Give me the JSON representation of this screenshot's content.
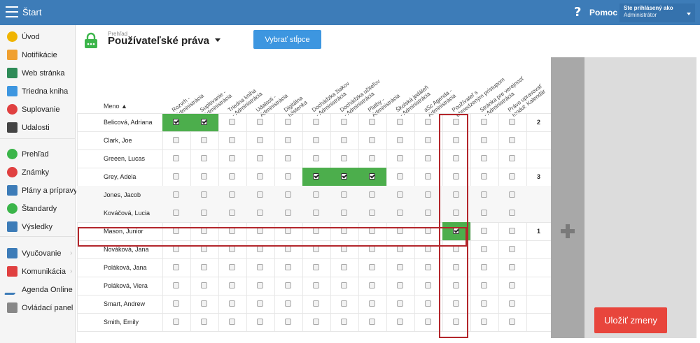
{
  "topbar": {
    "start_label": "Štart",
    "help_q": "?",
    "help_label": "Pomoc",
    "user_line1": "Ste prihlásený ako",
    "user_line2": "Administrátor"
  },
  "sidebar": {
    "items": [
      {
        "label": "Úvod",
        "icon": "star-icon",
        "color": "#f0b400"
      },
      {
        "label": "Notifikácie",
        "icon": "envelope-icon",
        "color": "#f0a030"
      },
      {
        "label": "Web stránka",
        "icon": "home-icon",
        "color": "#2e8b57"
      },
      {
        "label": "Triedna kniha",
        "icon": "book-icon",
        "color": "#3d96e0"
      },
      {
        "label": "Suplovanie",
        "icon": "person-icon",
        "color": "#e04040"
      },
      {
        "label": "Udalosti",
        "icon": "calendar-icon",
        "color": "#444444"
      },
      {
        "label": "Prehľad",
        "icon": "check-circle-icon",
        "color": "#3bb54a"
      },
      {
        "label": "Známky",
        "icon": "grade-icon",
        "color": "#e04040"
      },
      {
        "label": "Plány a prípravy",
        "icon": "briefcase-icon",
        "color": "#3d7cb8"
      },
      {
        "label": "Štandardy",
        "icon": "shield-icon",
        "color": "#3bb54a"
      },
      {
        "label": "Výsledky",
        "icon": "bar-chart-icon",
        "color": "#3d7cb8"
      },
      {
        "label": "Vyučovanie",
        "icon": "teacher-icon",
        "color": "#3d7cb8"
      },
      {
        "label": "Komunikácia",
        "icon": "chat-icon",
        "color": "#e04040"
      },
      {
        "label": "Agenda Online",
        "icon": "pencil-icon",
        "color": "#3d7cb8"
      },
      {
        "label": "Ovládací panel",
        "icon": "gear-icon",
        "color": "#888888"
      }
    ]
  },
  "header": {
    "crumb": "Prehľad",
    "title": "Používateľské práva",
    "select_columns": "Vybrať stĺpce"
  },
  "table": {
    "name_header": "Meno ▲",
    "columns": [
      [
        "Rozvrh -",
        "Administrácia"
      ],
      [
        "Suplovanie -",
        "Administrácia"
      ],
      [
        "Triedna kniha",
        "- Administrácia"
      ],
      [
        "Udalosti -",
        "Administrácia"
      ],
      [
        "Digitálna",
        "nástenka"
      ],
      [
        "Dochádzka žiakov",
        "- Administrácia"
      ],
      [
        "Dochádzka učiteľov",
        "- Administrácia"
      ],
      [
        "Platby -",
        "Administrácia"
      ],
      [
        "Školská jedáleň",
        "- Administrácia"
      ],
      [
        "aSc Agenda -",
        "Administrácia"
      ],
      [
        "Používateľ s",
        "obmedzeným prístupom"
      ],
      [
        "Stránka pre verejnosť",
        "- Administrácia"
      ],
      [
        "Právo upravovať",
        "modul: Kalendár"
      ]
    ],
    "rows": [
      {
        "name": "Belicová, Adriana",
        "checked": [
          0,
          1
        ],
        "count": "2"
      },
      {
        "name": "Clark, Joe",
        "checked": [],
        "count": ""
      },
      {
        "name": "Greeen, Lucas",
        "checked": [],
        "count": ""
      },
      {
        "name": "Grey, Adela",
        "checked": [
          5,
          6,
          7
        ],
        "count": "3"
      },
      {
        "name": "Jones, Jacob",
        "checked": [],
        "count": ""
      },
      {
        "name": "Kováčová, Lucia",
        "checked": [],
        "count": ""
      },
      {
        "name": "Mason, Junior",
        "checked": [
          10
        ],
        "count": "1"
      },
      {
        "name": "Nováková, Jana",
        "checked": [],
        "count": ""
      },
      {
        "name": "Poláková, Jana",
        "checked": [],
        "count": ""
      },
      {
        "name": "Poláková, Viera",
        "checked": [],
        "count": ""
      },
      {
        "name": "Smart, Andrew",
        "checked": [],
        "count": ""
      },
      {
        "name": "Smith, Emily",
        "checked": [],
        "count": ""
      }
    ]
  },
  "actions": {
    "save_label": "Uložiť zmeny"
  },
  "colors": {
    "primary": "#3d7cb8",
    "checked_cell": "#4cae4c",
    "save": "#e8453c",
    "highlight": "#b3262b"
  }
}
